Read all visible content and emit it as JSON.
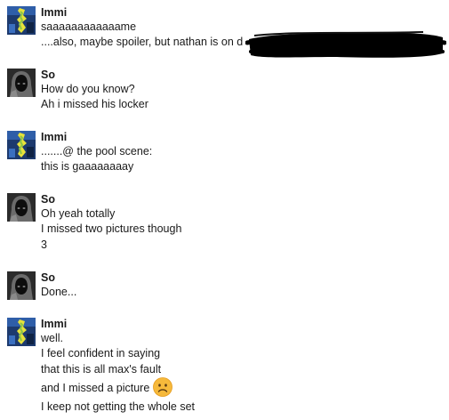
{
  "messages": [
    {
      "sender": "Immi",
      "avatar": "immi-avatar",
      "lines": [
        "saaaaaaaaaaaame",
        "....also, maybe spoiler, but nathan is on d"
      ]
    },
    {
      "sender": "So",
      "avatar": "so-avatar",
      "lines": [
        "How do you know?",
        "Ah i missed his locker"
      ]
    },
    {
      "sender": "Immi",
      "avatar": "immi-avatar",
      "lines": [
        ".......@ the pool scene:",
        "this is gaaaaaaaay"
      ]
    },
    {
      "sender": "So",
      "avatar": "so-avatar",
      "lines": [
        "Oh yeah totally",
        "I missed two pictures though",
        "3"
      ]
    },
    {
      "sender": "So",
      "avatar": "so-avatar",
      "lines": [
        "Done..."
      ]
    },
    {
      "sender": "Immi",
      "avatar": "immi-avatar",
      "lines": [
        "well.",
        "I feel confident in saying",
        "that this is all max's fault",
        "and I missed a picture",
        "I keep not getting the whole set"
      ],
      "emoji": "sad-face-icon"
    }
  ],
  "colors": {
    "text": "#1a1a1a",
    "emoji_fill": "#f6b93b",
    "redaction": "#000000"
  }
}
